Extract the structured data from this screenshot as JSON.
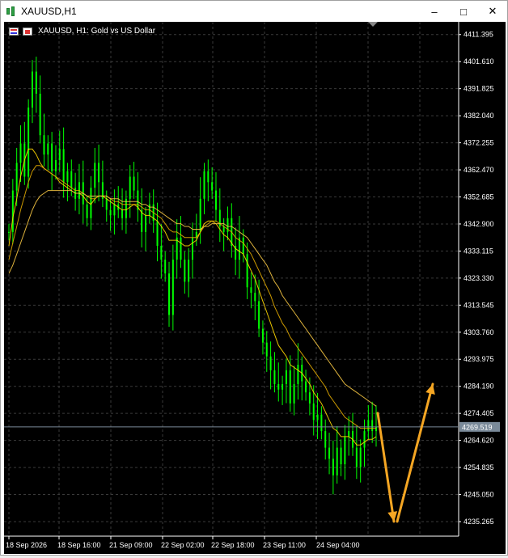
{
  "window": {
    "title": "XAUUSD,H1",
    "min_label": "–",
    "max_label": "□",
    "close_label": "✕"
  },
  "chart_header": {
    "symbol_text": "XAUUSD, H1:  Gold vs US Dollar"
  },
  "colors": {
    "background": "#000000",
    "grid": "#3a3a3a",
    "candles": "#00ff00",
    "ma_fast": "#ffd700",
    "ma_mid": "#e0a800",
    "ma_slow": "#f5c542",
    "arrows": "#f5a623",
    "axis_text": "#ffffff"
  },
  "chart_data": {
    "type": "line",
    "title": "XAUUSD, H1:  Gold vs US Dollar",
    "y_tick_labels": [
      "4411.395",
      "4401.610",
      "4391.825",
      "4382.040",
      "4372.255",
      "4362.470",
      "4352.685",
      "4342.900",
      "4333.115",
      "4323.330",
      "4313.545",
      "4303.760",
      "4293.975",
      "4284.190",
      "4274.405",
      "4264.620",
      "4254.835",
      "4245.050",
      "4235.265"
    ],
    "x_tick_labels": [
      "18 Sep 2026",
      "18 Sep 16:00",
      "21 Sep 09:00",
      "22 Sep 02:00",
      "22 Sep 18:00",
      "23 Sep 11:00",
      "24 Sep 04:00"
    ],
    "current_price_label": "4269.519",
    "ylim": [
      4230,
      4416
    ],
    "price": [
      4340,
      4355,
      4365,
      4372,
      4360,
      4385,
      4398,
      4390,
      4375,
      4368,
      4372,
      4362,
      4366,
      4370,
      4358,
      4362,
      4356,
      4352,
      4358,
      4350,
      4345,
      4356,
      4365,
      4358,
      4352,
      4348,
      4346,
      4350,
      4348,
      4345,
      4352,
      4360,
      4355,
      4348,
      4340,
      4346,
      4350,
      4344,
      4335,
      4330,
      4325,
      4310,
      4330,
      4338,
      4330,
      4322,
      4330,
      4338,
      4340,
      4352,
      4362,
      4358,
      4355,
      4348,
      4342,
      4340,
      4345,
      4335,
      4330,
      4338,
      4332,
      4320,
      4318,
      4315,
      4305,
      4300,
      4295,
      4290,
      4285,
      4283,
      4285,
      4290,
      4278,
      4285,
      4292,
      4286,
      4282,
      4278,
      4272,
      4274,
      4268,
      4262,
      4258,
      4252,
      4262,
      4256,
      4266,
      4268,
      4262,
      4255,
      4262,
      4268,
      4272,
      4268,
      4269.5
    ],
    "series": [
      {
        "name": "",
        "values": [
          4335,
          4345,
          4352,
          4360,
          4366,
          4370,
          4370,
          4368,
          4365,
          4363,
          4362,
          4361,
          4360,
          4358,
          4357,
          4356,
          4355,
          4354,
          4354,
          4353,
          4351,
          4350,
          4352,
          4353,
          4353,
          4352,
          4351,
          4350,
          4349,
          4348,
          4348,
          4349,
          4350,
          4349,
          4347,
          4346,
          4346,
          4345,
          4344,
          4342,
          4340,
          4337,
          4337,
          4337,
          4336,
          4335,
          4335,
          4336,
          4337,
          4340,
          4343,
          4344,
          4344,
          4343,
          4341,
          4339,
          4338,
          4336,
          4334,
          4333,
          4332,
          4329,
          4326,
          4323,
          4319,
          4315,
          4311,
          4307,
          4303,
          4299,
          4297,
          4295,
          4292,
          4291,
          4290,
          4289,
          4287,
          4285,
          4282,
          4280,
          4278,
          4275,
          4272,
          4269,
          4268,
          4266,
          4266,
          4266,
          4265,
          4263,
          4263,
          4264,
          4265,
          4265,
          4266
        ]
      },
      {
        "name": "",
        "values": [
          4330,
          4336,
          4342,
          4348,
          4353,
          4358,
          4362,
          4364,
          4364,
          4363,
          4362,
          4361,
          4360,
          4359,
          4358,
          4357,
          4356,
          4355,
          4355,
          4354,
          4353,
          4352,
          4352,
          4353,
          4353,
          4353,
          4352,
          4351,
          4351,
          4350,
          4350,
          4350,
          4350,
          4350,
          4349,
          4348,
          4348,
          4347,
          4346,
          4345,
          4343,
          4341,
          4340,
          4340,
          4339,
          4338,
          4338,
          4338,
          4338,
          4340,
          4342,
          4343,
          4344,
          4344,
          4343,
          4342,
          4341,
          4340,
          4338,
          4337,
          4336,
          4334,
          4332,
          4329,
          4326,
          4323,
          4320,
          4317,
          4313,
          4310,
          4307,
          4305,
          4302,
          4300,
          4298,
          4296,
          4294,
          4292,
          4290,
          4288,
          4286,
          4284,
          4281,
          4279,
          4277,
          4275,
          4273,
          4272,
          4271,
          4270,
          4269,
          4269,
          4269,
          4269,
          4269
        ]
      },
      {
        "name": "",
        "values": [
          4325,
          4328,
          4332,
          4336,
          4340,
          4344,
          4348,
          4351,
          4353,
          4354,
          4355,
          4355,
          4355,
          4355,
          4355,
          4355,
          4355,
          4354,
          4354,
          4354,
          4353,
          4353,
          4353,
          4353,
          4353,
          4353,
          4352,
          4352,
          4352,
          4351,
          4351,
          4351,
          4351,
          4351,
          4350,
          4350,
          4349,
          4349,
          4348,
          4347,
          4346,
          4345,
          4344,
          4343,
          4343,
          4342,
          4342,
          4341,
          4341,
          4341,
          4342,
          4342,
          4343,
          4343,
          4343,
          4343,
          4342,
          4342,
          4341,
          4340,
          4339,
          4338,
          4336,
          4334,
          4332,
          4330,
          4328,
          4325,
          4322,
          4320,
          4317,
          4315,
          4313,
          4311,
          4309,
          4307,
          4305,
          4303,
          4301,
          4299,
          4297,
          4295,
          4293,
          4291,
          4289,
          4287,
          4285,
          4284,
          4283,
          4282,
          4281,
          4280,
          4279,
          4278,
          4277
        ]
      }
    ],
    "annotations": [
      {
        "type": "arrow",
        "from_price": 4274.5,
        "to_price": 4235.3,
        "direction": "down"
      },
      {
        "type": "arrow",
        "from_price": 4235.3,
        "to_price": 4285.0,
        "direction": "up"
      }
    ]
  }
}
